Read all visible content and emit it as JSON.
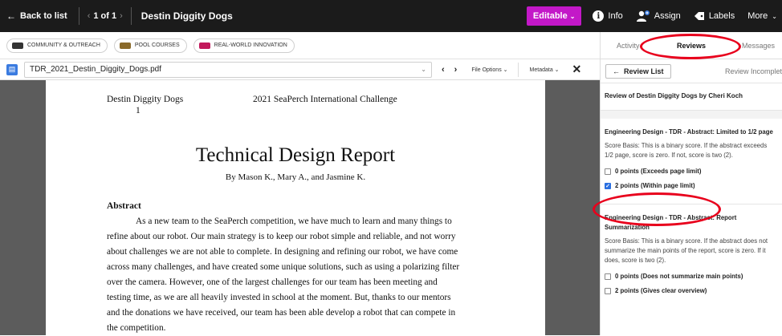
{
  "topbar": {
    "back_label": "Back to list",
    "pager": "1 of 1",
    "title": "Destin Diggity Dogs",
    "editable_label": "Editable",
    "info_label": "Info",
    "assign_label": "Assign",
    "labels_label": "Labels",
    "more_label": "More",
    "editable_color": "#c318c8"
  },
  "labels": [
    {
      "text": "COMMUNITY & OUTREACH",
      "color": "#333333"
    },
    {
      "text": "POOL COURSES",
      "color": "#8a6a2a"
    },
    {
      "text": "REAL-WORLD INNOVATION",
      "color": "#c2185b"
    }
  ],
  "filebar": {
    "file_name": "TDR_2021_Destin_Diggity_Dogs.pdf",
    "file_options": "File Options",
    "metadata": "Metadata"
  },
  "document": {
    "header_left": "Destin Diggity Dogs",
    "page_number": "1",
    "header_right": "2021 SeaPerch International Challenge",
    "title": "Technical Design Report",
    "byline": "By Mason K., Mary A., and Jasmine K.",
    "abstract_heading": "Abstract",
    "abstract_lines": [
      "As a new team to the SeaPerch competition, we have much to learn and many things to",
      "refine about our robot. Our main strategy is to keep our robot simple and reliable, and not worry",
      "about challenges we are not able to complete. In designing and refining our robot, we have come",
      "across many challenges, and have created some unique solutions, such as using a polarizing filter",
      "over the camera. However, one of the largest challenges for our team has been meeting and",
      "testing time, as we are all heavily invested in school at the moment. But, thanks to our mentors",
      "and the donations we have received, our team has been able develop a robot that can compete in",
      "the competition."
    ]
  },
  "panel": {
    "tabs": [
      "Activity",
      "Reviews",
      "Messages"
    ],
    "active_tab": "Reviews",
    "review_list_label": "Review List",
    "review_status": "Review Incomplete",
    "review_title": "Review of Destin Diggity Dogs by Cheri Koch",
    "criteria": [
      {
        "title": "Engineering Design - TDR - Abstract: Limited to 1/2 page",
        "basis": "Score Basis: This is a binary score. If the abstract exceeds 1/2 page, score is zero. If not, score is two (2).",
        "options": [
          {
            "label": "0 points (Exceeds page limit)",
            "checked": false
          },
          {
            "label": "2 points (Within page limit)",
            "checked": true
          }
        ]
      },
      {
        "title": "Engineering Design - TDR - Abstract: Report Summarization",
        "basis": "Score Basis: This is a binary score. If the abstract does not summarize the main points of the report, score is zero. If it does, score is two (2).",
        "options": [
          {
            "label": "0 points (Does not summarize main points)",
            "checked": false
          },
          {
            "label": "2 points (Gives clear overview)",
            "checked": false
          }
        ]
      }
    ]
  },
  "annotation_color": "#e8001c"
}
